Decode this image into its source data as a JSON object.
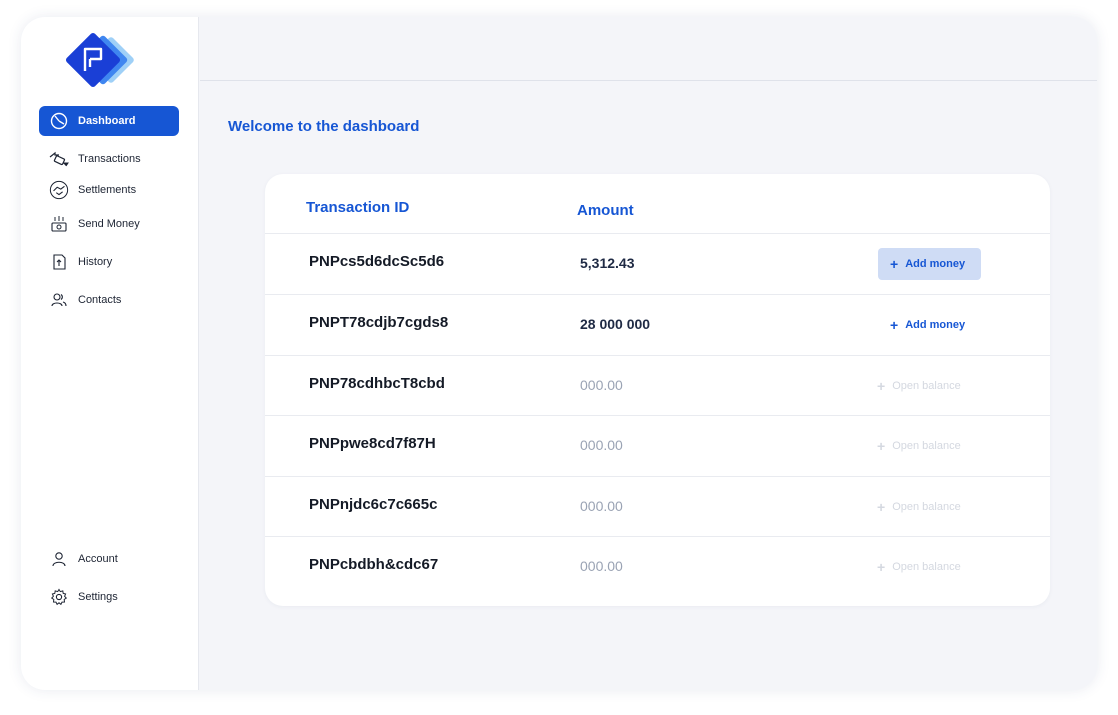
{
  "sidebar": {
    "logo_icon": "pnp-diamond-logo",
    "items": [
      {
        "label": "Dashboard",
        "icon": "dashboard-gauge-icon",
        "active": true
      },
      {
        "label": "Transactions",
        "icon": "transactions-cards-icon",
        "active": false
      },
      {
        "label": "Settlements",
        "icon": "handshake-icon",
        "active": false
      },
      {
        "label": "Send Money",
        "icon": "send-money-cash-icon",
        "active": false
      },
      {
        "label": "History",
        "icon": "history-document-icon",
        "active": false
      },
      {
        "label": "Contacts",
        "icon": "contacts-people-icon",
        "active": false
      }
    ],
    "bottom_items": [
      {
        "label": "Account",
        "icon": "user-icon"
      },
      {
        "label": "Settings",
        "icon": "gear-icon"
      }
    ]
  },
  "main": {
    "welcome": "Welcome to the dashboard",
    "table": {
      "headers": {
        "transaction_id": "Transaction ID",
        "amount": "Amount"
      },
      "rows": [
        {
          "id": "PNPcs5d6dcSc5d6",
          "amount": "5,312.43",
          "action": "Add money",
          "state": "highlighted"
        },
        {
          "id": "PNPT78cdjb7cgds8",
          "amount": "28 000 000",
          "action": "Add money",
          "state": "normal"
        },
        {
          "id": "PNP78cdhbcT8cbd",
          "amount": "000.00",
          "action": "Open balance",
          "state": "disabled"
        },
        {
          "id": "PNPpwe8cd7f87H",
          "amount": "000.00",
          "action": "Open balance",
          "state": "disabled"
        },
        {
          "id": "PNPnjdc6c7c665c",
          "amount": "000.00",
          "action": "Open balance",
          "state": "disabled"
        },
        {
          "id": "PNPcbdbh&cdc67",
          "amount": "000.00",
          "action": "Open balance",
          "state": "disabled"
        }
      ]
    }
  },
  "colors": {
    "accent": "#1656d4",
    "accent_light": "#cfdcf5",
    "background": "#f4f5f9",
    "disabled_text": "#d4d8e0"
  }
}
